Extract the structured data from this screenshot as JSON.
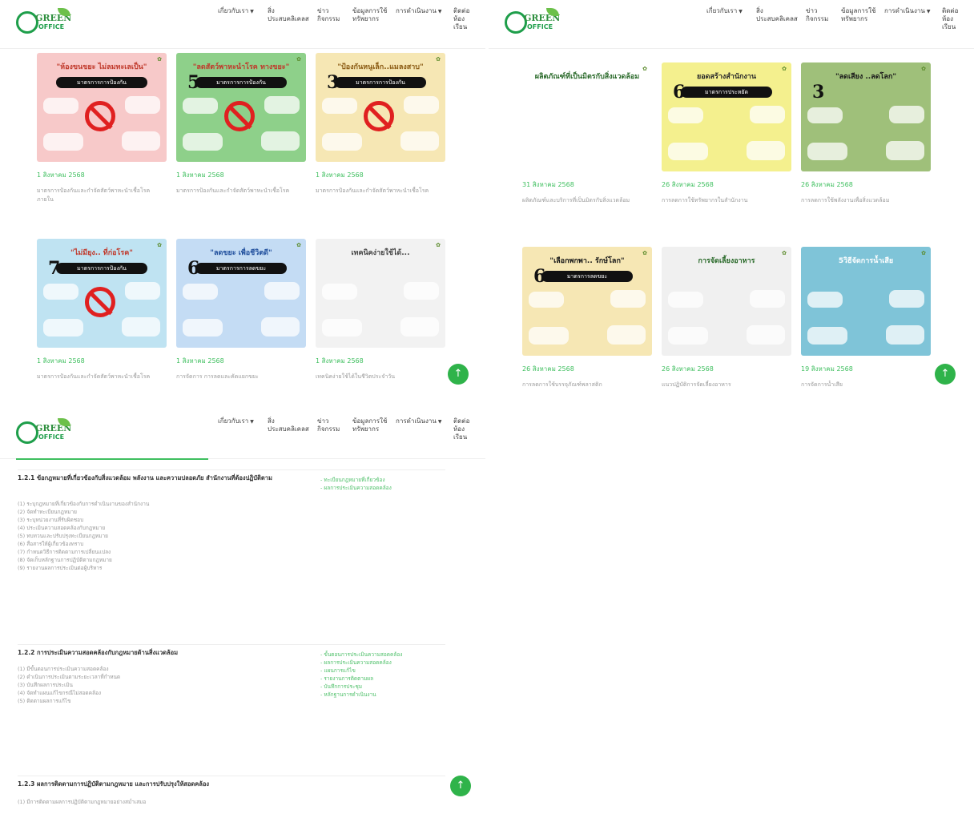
{
  "nav": [
    {
      "label": "เกี่ยวกับเรา",
      "dropdown": true
    },
    {
      "label": "สิ่ง\nประสบคลิเคลส",
      "dropdown": false
    },
    {
      "label": "ข่าว\nกิจกรรม",
      "dropdown": false
    },
    {
      "label": "ข้อมูลการใช้\nทรัพยากร",
      "dropdown": false
    },
    {
      "label": "การดำเนินงาน",
      "dropdown": true
    },
    {
      "label": "ติดต่อ\nห้อง\nเรียน",
      "dropdown": false
    }
  ],
  "logo": {
    "text_top": "GREEN",
    "text_bottom": "OFFICE"
  },
  "scroll_top_icon": "↑",
  "panel1_posts": [
    {
      "title": "\"ห้องขนขยะ ไม่ลมทะเลเป็น\"",
      "badge": "มาตรการการป้องกัน",
      "num": "",
      "date": "1 สิงหาคม 2568",
      "excerpt": "มาตรการป้องกันและกำจัดสัตว์พาหะนำเชื้อโรคภายใน",
      "bg": "#f7c9c9",
      "title_color": "#c0392b"
    },
    {
      "title": "\"ลดสัตว์พาหะนำโรค ทางขยะ\"",
      "badge": "มาตรการการป้องกัน",
      "num": "5",
      "date": "1 สิงหาคม 2568",
      "excerpt": "มาตรการป้องกันและกำจัดสัตว์พาหะนำเชื้อโรค",
      "bg": "#8ed08a",
      "title_color": "#c0392b"
    },
    {
      "title": "\"ป้องกันหนูเล็ก..แมลงสาบ\"",
      "badge": "มาตรการการป้องกัน",
      "num": "3",
      "date": "1 สิงหาคม 2568",
      "excerpt": "มาตรการป้องกันและกำจัดสัตว์พาหะนำเชื้อโรค",
      "bg": "#f6e7b4",
      "title_color": "#8a5a12"
    },
    {
      "title": "\"ไม่มียุง.. ที่ก่อโรค\"",
      "badge": "มาตรการการป้องกัน",
      "num": "7",
      "date": "1 สิงหาคม 2568",
      "excerpt": "มาตรการป้องกันและกำจัดสัตว์พาหะนำเชื้อโรค",
      "bg": "#bfe3f2",
      "title_color": "#c0392b"
    },
    {
      "title": "\"ลดขยะ เพื่อชีวิตดี\"",
      "badge": "มาตรการการลดขยะ",
      "num": "6",
      "date": "1 สิงหาคม 2568",
      "excerpt": "การจัดการ การลดและคัดแยกขยะ",
      "bg": "#c4dcf4",
      "title_color": "#1f4e9c"
    },
    {
      "title": "เทคนิคง่ายใช้ได้...",
      "badge": "",
      "num": "",
      "date": "1 สิงหาคม 2568",
      "excerpt": "เทคนิคง่ายใช้ได้ในชีวิตประจำวัน",
      "bg": "#f2f2f2",
      "title_color": "#444"
    }
  ],
  "panel2_posts": [
    {
      "title": "ผลิตภัณฑ์ที่เป็นมิตรกับสิ่งแวดล้อม",
      "badge": "",
      "num": "",
      "date": "31 สิงหาคม 2568",
      "excerpt": "ผลิตภัณฑ์และบริการที่เป็นมิตรกับสิ่งแวดล้อม",
      "bg": "#ffffff",
      "title_color": "#2a6a2a"
    },
    {
      "title": "ยอดสร้างสำนักงาน",
      "badge": "มาตรการประหยัด",
      "num": "6",
      "date": "26 สิงหาคม 2568",
      "excerpt": "การลดการใช้ทรัพยากรในสำนักงาน",
      "bg": "#f4f08e",
      "title_color": "#2a2a2a"
    },
    {
      "title": "\"ลดเสียง ..ลดโลก\"",
      "badge": "",
      "num": "3",
      "date": "26 สิงหาคม 2568",
      "excerpt": "การลดการใช้พลังงานเพื่อสิ่งแวดล้อม",
      "bg": "#9fc07a",
      "title_color": "#1a1a1a"
    },
    {
      "title": "\"เลือกพกพา.. รักษ์โลก\"",
      "badge": "มาตรการลดขยะ",
      "num": "6",
      "date": "26 สิงหาคม 2568",
      "excerpt": "การลดการใช้บรรจุภัณฑ์พลาสติก",
      "bg": "#f6e7b4",
      "title_color": "#1a1a1a"
    },
    {
      "title": "การจัดเลี้ยงอาหาร",
      "badge": "",
      "num": "",
      "date": "26 สิงหาคม 2568",
      "excerpt": "แนวปฏิบัติการจัดเลี้ยงอาหาร",
      "bg": "#f0f0f0",
      "title_color": "#2a6a2a"
    },
    {
      "title": "5วิธีจัดการน้ำเสีย",
      "badge": "",
      "num": "",
      "date": "19 สิงหาคม 2568",
      "excerpt": "การจัดการน้ำเสีย",
      "bg": "#7fc4d8",
      "title_color": "#ffffff"
    }
  ],
  "doc": {
    "h1": "1.2.1 ข้อกฎหมายที่เกี่ยวข้องกับสิ่งแวดล้อม พลังงาน และความปลอดภัย สำนักงานที่ต้องปฏิบัติตาม",
    "list1": [
      "(1) ระบุกฎหมายที่เกี่ยวข้องกับการดำเนินงานของสำนักงาน",
      "(2) จัดทำทะเบียนกฎหมาย",
      "(3) ระบุหน่วยงานที่รับผิดชอบ",
      "(4) ประเมินความสอดคล้องกับกฎหมาย",
      "(5) ทบทวนและปรับปรุงทะเบียนกฎหมาย",
      "(6) สื่อสารให้ผู้เกี่ยวข้องทราบ",
      "(7) กำหนดวิธีการติดตามการเปลี่ยนแปลง",
      "(8) จัดเก็บหลักฐานการปฏิบัติตามกฎหมาย",
      "(9) รายงานผลการประเมินต่อผู้บริหาร"
    ],
    "ref1": [
      "- ทะเบียนกฎหมายที่เกี่ยวข้อง",
      "- ผลการประเมินความสอดคล้อง"
    ],
    "h2": "1.2.2 การประเมินความสอดคล้องกับกฎหมายด้านสิ่งแวดล้อม",
    "list2": [
      "(1) มีขั้นตอนการประเมินความสอดคล้อง",
      "(2) ดำเนินการประเมินตามระยะเวลาที่กำหนด",
      "(3) บันทึกผลการประเมิน",
      "(4) จัดทำแผนแก้ไขกรณีไม่สอดคล้อง",
      "(5) ติดตามผลการแก้ไข"
    ],
    "ref2": [
      "- ขั้นตอนการประเมินความสอดคล้อง",
      "- ผลการประเมินความสอดคล้อง",
      "- แผนการแก้ไข",
      "- รายงานการติดตามผล",
      "- บันทึกการประชุม",
      "- หลักฐานการดำเนินงาน"
    ],
    "h3": "1.2.3 ผลการติดตามการปฏิบัติตามกฎหมาย และการปรับปรุงให้สอดคล้อง",
    "list3": [
      "(1) มีการติดตามผลการปฏิบัติตามกฎหมายอย่างสม่ำเสมอ"
    ]
  }
}
